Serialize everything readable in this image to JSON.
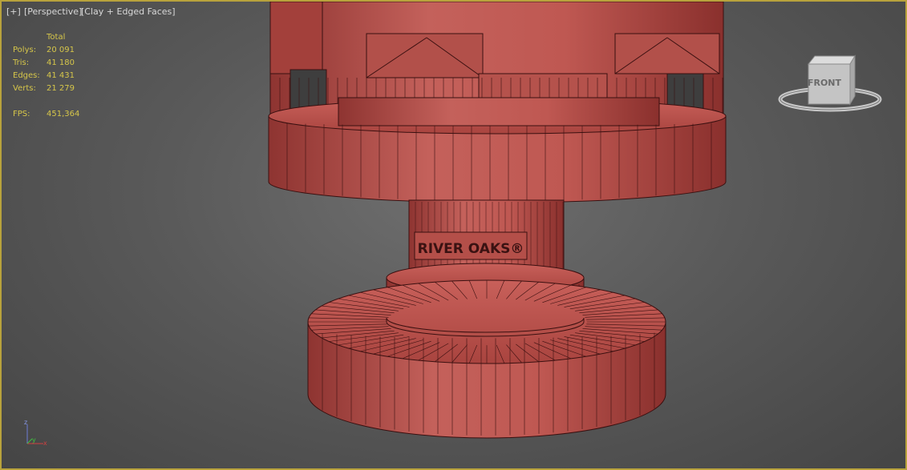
{
  "viewport": {
    "label_plus": "[+]",
    "label_view": "[Perspective]",
    "label_shading": "[Clay + Edged Faces]"
  },
  "stats": {
    "header": "Total",
    "rows": [
      {
        "label": "Polys:",
        "value": "20 091"
      },
      {
        "label": "Tris:",
        "value": "41 180"
      },
      {
        "label": "Edges:",
        "value": "41 431"
      },
      {
        "label": "Verts:",
        "value": "21 279"
      }
    ],
    "fps_label": "FPS:",
    "fps_value": "451,364"
  },
  "viewcube": {
    "face_label": "FRONT"
  },
  "axis_gizmo": {
    "z": "z",
    "y": "y",
    "x": "x"
  },
  "model": {
    "engraving": "RIVER OAKS®"
  },
  "colors": {
    "viewport_border": "#b8a23c",
    "stats_text": "#d6c64a",
    "clay": "#b34a45",
    "clay_dark": "#7a2b28",
    "edge_lines": "#3a1010"
  }
}
